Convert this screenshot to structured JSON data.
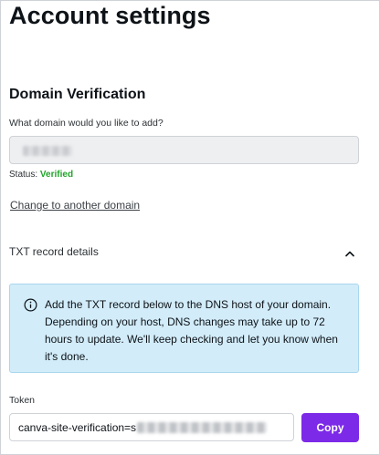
{
  "page": {
    "title": "Account settings"
  },
  "domain_verification": {
    "title": "Domain Verification",
    "question": "What domain would you like to add?",
    "status_label": "Status:",
    "status_value": "Verified",
    "change_link": "Change to another domain"
  },
  "txt_record": {
    "header": "TXT record details",
    "info": "Add the TXT record below to the DNS host of your domain. Depending on your host, DNS changes may take up to 72 hours to update. We'll keep checking and let you know when it's done."
  },
  "token": {
    "label": "Token",
    "value_prefix": "canva-site-verification=s",
    "copy_label": "Copy"
  },
  "colors": {
    "accent": "#7d2ae8",
    "verified": "#21a42a",
    "info_bg": "#d2ecf9"
  }
}
